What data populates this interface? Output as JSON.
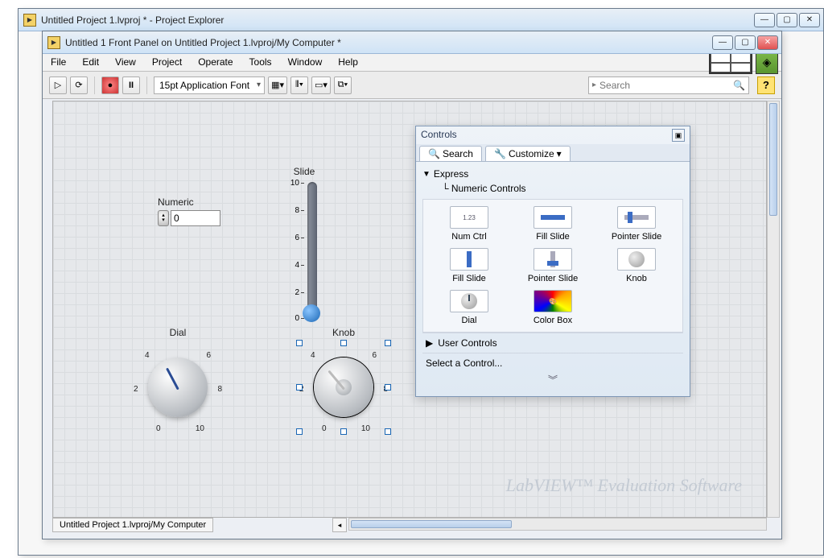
{
  "bg_window": {
    "title": "Untitled Project 1.lvproj * - Project Explorer"
  },
  "front_window": {
    "title": "Untitled 1 Front Panel on Untitled Project 1.lvproj/My Computer *",
    "menu": [
      "File",
      "Edit",
      "View",
      "Project",
      "Operate",
      "Tools",
      "Window",
      "Help"
    ],
    "font": "15pt Application Font",
    "search_placeholder": "Search",
    "help": "?"
  },
  "fp": {
    "numeric_label": "Numeric",
    "numeric_value": "0",
    "slide_label": "Slide",
    "slide_ticks": [
      "10",
      "8",
      "6",
      "4",
      "2",
      "0"
    ],
    "dial_label": "Dial",
    "knob_label": "Knob",
    "knob_ticks": [
      "0",
      "2",
      "4",
      "6",
      "8",
      "10"
    ]
  },
  "palette": {
    "title": "Controls",
    "search": "Search",
    "customize": "Customize",
    "category": "Express",
    "subcategory": "Numeric Controls",
    "items": [
      "Num Ctrl",
      "Fill Slide",
      "Pointer Slide",
      "Fill Slide",
      "Pointer Slide",
      "Knob",
      "Dial",
      "Color Box"
    ],
    "user_controls": "User Controls",
    "select_control": "Select a Control..."
  },
  "status": {
    "path": "Untitled Project 1.lvproj/My Computer"
  },
  "watermark": "LabVIEW™ Evaluation Software"
}
